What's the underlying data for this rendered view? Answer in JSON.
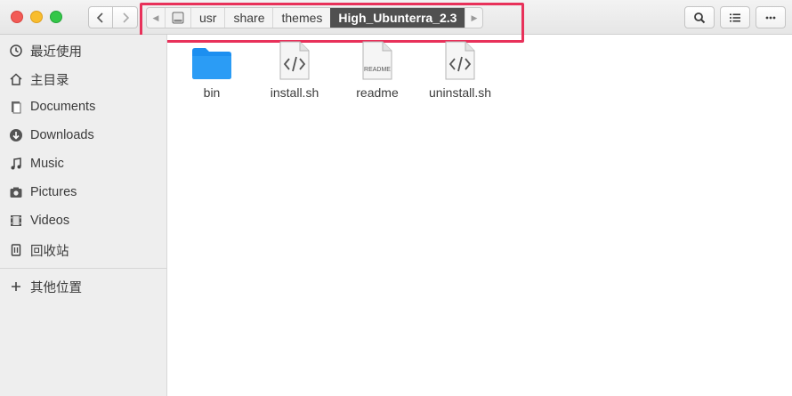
{
  "toolbar": {
    "path": [
      "usr",
      "share",
      "themes",
      "High_Ubunterra_2.3"
    ]
  },
  "sidebar": {
    "items": [
      {
        "label": "最近使用",
        "icon": "recent-icon"
      },
      {
        "label": "主目录",
        "icon": "home-icon"
      },
      {
        "label": "Documents",
        "icon": "documents-icon"
      },
      {
        "label": "Downloads",
        "icon": "downloads-icon"
      },
      {
        "label": "Music",
        "icon": "music-icon"
      },
      {
        "label": "Pictures",
        "icon": "pictures-icon"
      },
      {
        "label": "Videos",
        "icon": "videos-icon"
      },
      {
        "label": "回收站",
        "icon": "trash-icon"
      }
    ],
    "other": {
      "label": "其他位置",
      "icon": "plus-icon"
    }
  },
  "files": [
    {
      "name": "bin",
      "icon": "folder-icon"
    },
    {
      "name": "install.sh",
      "icon": "script-file-icon"
    },
    {
      "name": "readme",
      "icon": "readme-file-icon",
      "icon_text": "README"
    },
    {
      "name": "uninstall.sh",
      "icon": "script-file-icon"
    }
  ],
  "colors": {
    "path_current_bg": "#505050",
    "highlight_border": "#e8315a",
    "folder_blue": "#1c8ff0"
  }
}
